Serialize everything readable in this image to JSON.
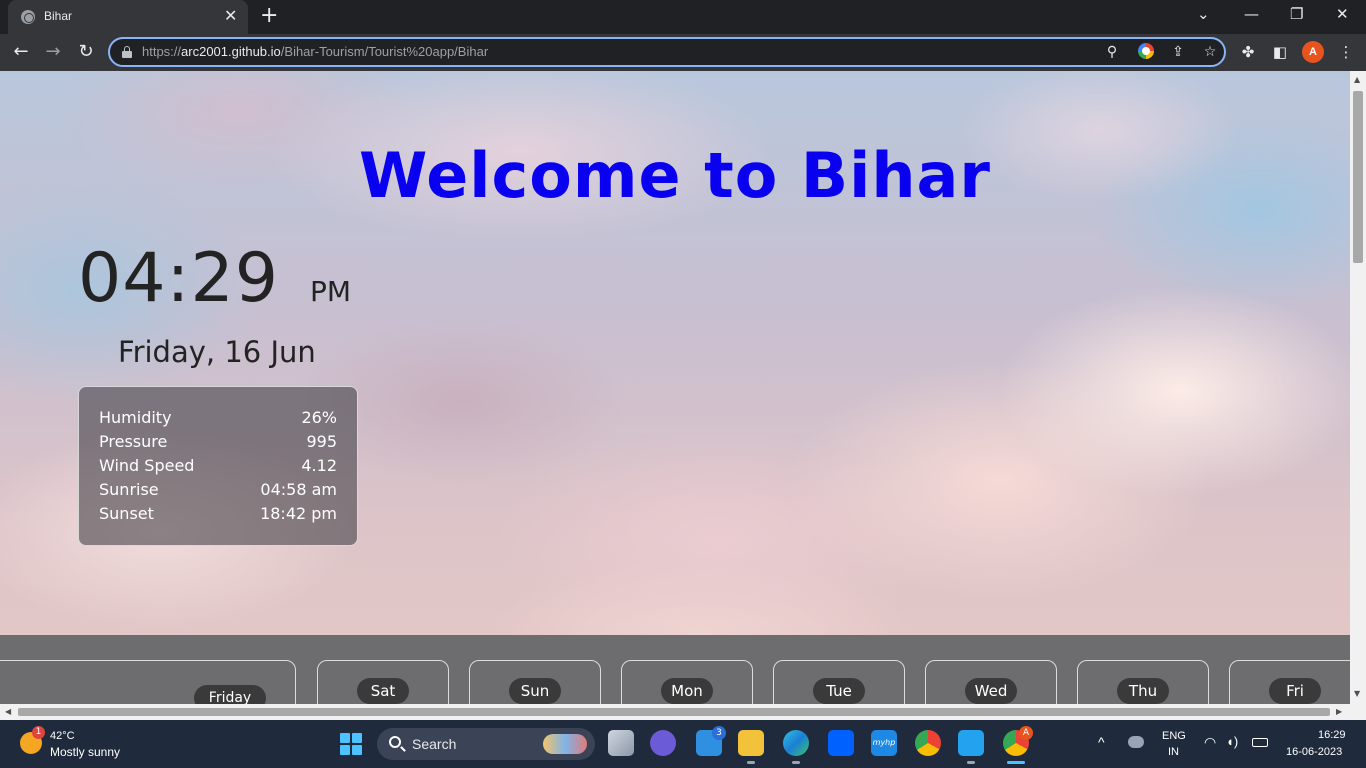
{
  "browser": {
    "tab_title": "Bihar",
    "close_glyph": "✕",
    "new_tab_glyph": "+",
    "url_prefix": "https://",
    "url_host": "arc2001.github.io",
    "url_path": "/Bihar-Tourism/Tourist%20app/Bihar",
    "profile_initial": "A",
    "icons": [
      "back-icon",
      "forward-icon",
      "reload-icon",
      "lock-icon",
      "location-icon",
      "google-icon",
      "share-icon",
      "star-icon",
      "extensions-icon",
      "side-panel-icon",
      "menu-icon"
    ]
  },
  "page": {
    "heading": "Welcome to Bihar",
    "time": "04:29",
    "ampm": "PM",
    "date": "Friday, 16 Jun",
    "weather": [
      {
        "label": "Humidity",
        "value": "26%"
      },
      {
        "label": "Pressure",
        "value": "995"
      },
      {
        "label": "Wind Speed",
        "value": "4.12"
      },
      {
        "label": "Sunrise",
        "value": "04:58 am"
      },
      {
        "label": "Sunset",
        "value": "18:42 pm"
      }
    ],
    "forecast_today": "Friday",
    "forecast_days": [
      "Sat",
      "Sun",
      "Mon",
      "Tue",
      "Wed",
      "Thu",
      "Fri"
    ]
  },
  "taskbar": {
    "weather_badge": "1",
    "temperature": "42°C",
    "condition": "Mostly sunny",
    "search_label": "Search",
    "mail_badge": "3",
    "chrome_badge": "A",
    "hp_label": "myhp",
    "lang": "ENG",
    "region": "IN",
    "clock_time": "16:29",
    "clock_date": "16-06-2023"
  }
}
